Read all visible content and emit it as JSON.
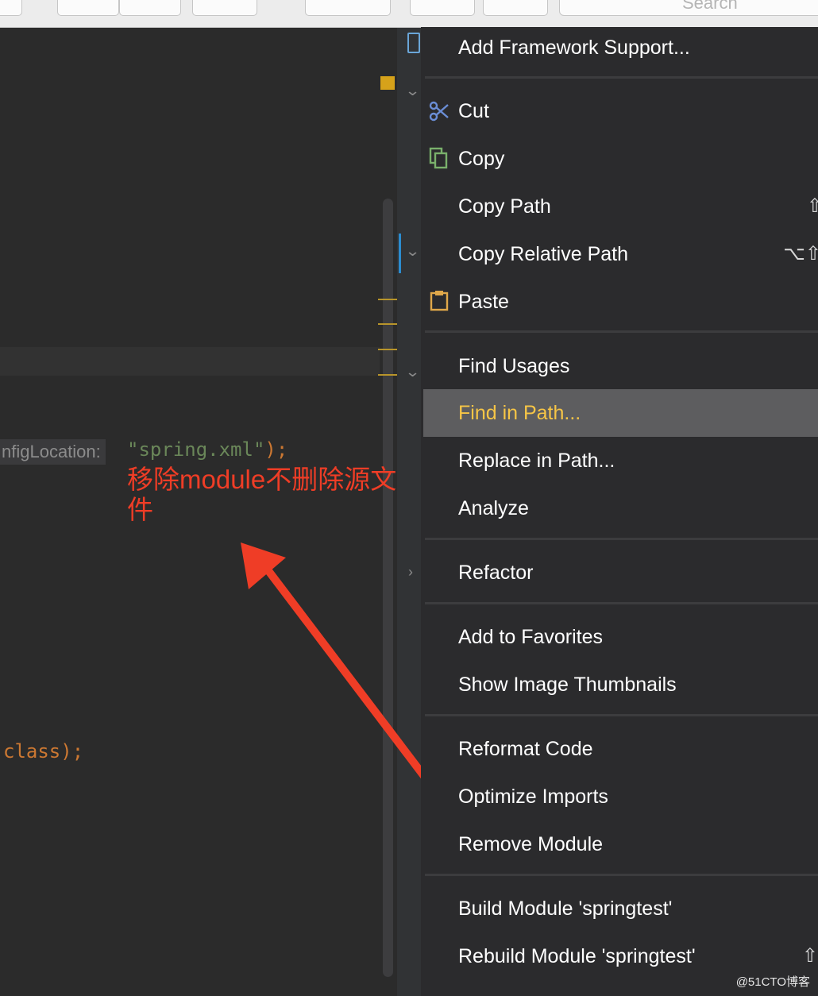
{
  "toolbar": {
    "search_placeholder": "Search"
  },
  "editor": {
    "param_hint": "nfigLocation:",
    "string_literal": "\"spring.xml\"",
    "string_tail": ");",
    "class_keyword": "class",
    "class_tail": ");"
  },
  "annotation": {
    "text": "移除module不删除源文件"
  },
  "context_menu": {
    "items": [
      {
        "label": "Add Framework Support..."
      },
      {
        "label": "Cut",
        "icon": "scissors-icon"
      },
      {
        "label": "Copy",
        "icon": "copy-icon"
      },
      {
        "label": "Copy Path",
        "shortcut": "⇧"
      },
      {
        "label": "Copy Relative Path",
        "shortcut": "⌥⇧"
      },
      {
        "label": "Paste",
        "icon": "clipboard-icon"
      },
      {
        "label": "Find Usages"
      },
      {
        "label": "Find in Path...",
        "selected": true
      },
      {
        "label": "Replace in Path..."
      },
      {
        "label": "Analyze"
      },
      {
        "label": "Refactor",
        "submenu": true
      },
      {
        "label": "Add to Favorites"
      },
      {
        "label": "Show Image Thumbnails"
      },
      {
        "label": "Reformat Code"
      },
      {
        "label": "Optimize Imports"
      },
      {
        "label": "Remove Module"
      },
      {
        "label": "Build Module 'springtest'"
      },
      {
        "label": "Rebuild Module 'springtest'",
        "shortcut": "⇧"
      }
    ]
  },
  "watermark": "@51CTO博客",
  "colors": {
    "editor_bg": "#2b2b2b",
    "menu_bg": "#2b2b2d",
    "selected_item_bg": "#5d5d5f",
    "selected_item_text": "#f6c546",
    "annotation_red": "#ef3d26",
    "string_green": "#6a8759",
    "keyword_orange": "#cc7832"
  }
}
